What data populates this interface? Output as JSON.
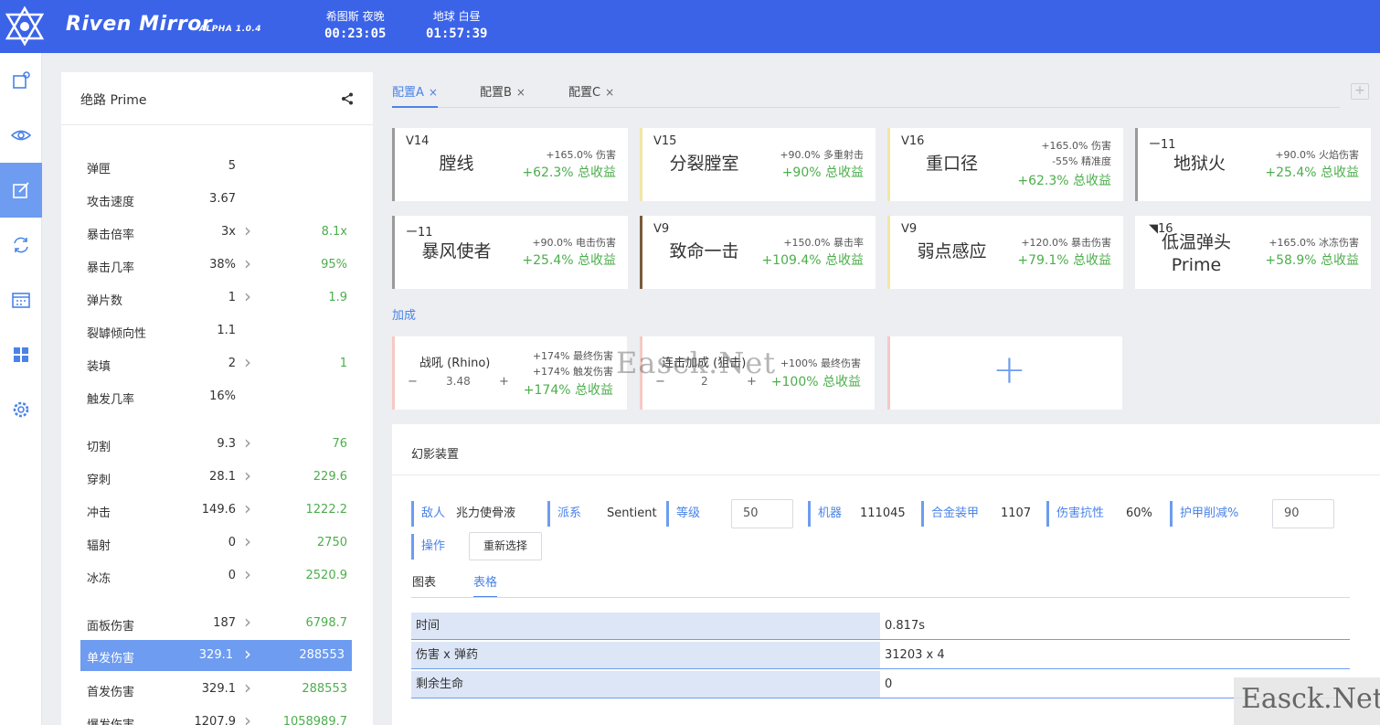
{
  "app": {
    "brand": "Riven Mirror",
    "version": "ALPHA 1.0.4",
    "clocks": [
      {
        "name": "希图斯 夜晚",
        "time": "00:23:05"
      },
      {
        "name": "地球 白昼",
        "time": "01:57:39"
      }
    ],
    "colors": {
      "topbar": "#3b63e8",
      "accent": "#4a83e8",
      "positive": "#4cae4c"
    }
  },
  "rail": [
    "riven-icon",
    "eye-icon",
    "edit-icon",
    "sync-icon",
    "calendar-icon",
    "grid-icon",
    "settings-icon"
  ],
  "stats": {
    "title": "绝路 Prime",
    "rows": [
      {
        "label": "弹匣",
        "value": "5",
        "arrow": false,
        "result": ""
      },
      {
        "label": "攻击速度",
        "value": "3.67",
        "arrow": false,
        "result": ""
      },
      {
        "label": "暴击倍率",
        "value": "3x",
        "arrow": true,
        "result": "8.1x"
      },
      {
        "label": "暴击几率",
        "value": "38%",
        "arrow": true,
        "result": "95%"
      },
      {
        "label": "弹片数",
        "value": "1",
        "arrow": true,
        "result": "1.9"
      },
      {
        "label": "裂罅倾向性",
        "value": "1.1",
        "arrow": false,
        "result": ""
      },
      {
        "label": "装填",
        "value": "2",
        "arrow": true,
        "result": "1"
      },
      {
        "label": "触发几率",
        "value": "16%",
        "arrow": false,
        "result": ""
      },
      {
        "label": "切割",
        "value": "9.3",
        "arrow": true,
        "result": "76"
      },
      {
        "label": "穿刺",
        "value": "28.1",
        "arrow": true,
        "result": "229.6"
      },
      {
        "label": "冲击",
        "value": "149.6",
        "arrow": true,
        "result": "1222.2"
      },
      {
        "label": "辐射",
        "value": "0",
        "arrow": true,
        "result": "2750"
      },
      {
        "label": "冰冻",
        "value": "0",
        "arrow": true,
        "result": "2520.9"
      },
      {
        "label": "面板伤害",
        "value": "187",
        "arrow": true,
        "result": "6798.7"
      },
      {
        "label": "单发伤害",
        "value": "329.1",
        "arrow": true,
        "result": "288553"
      },
      {
        "label": "首发伤害",
        "value": "329.1",
        "arrow": true,
        "result": "288553"
      },
      {
        "label": "爆发伤害",
        "value": "1207.9",
        "arrow": true,
        "result": "1058989.7"
      }
    ]
  },
  "tabs": [
    {
      "label": "配置A",
      "close": "×"
    },
    {
      "label": "配置B",
      "close": "×"
    },
    {
      "label": "配置C",
      "close": "×"
    }
  ],
  "tab_add": "+",
  "mods": [
    {
      "rank": "ᐯ14",
      "name": "膛线",
      "effects": [
        "+165.0% 伤害"
      ],
      "gain": "+62.3% 总收益",
      "color": "#9a9a9a"
    },
    {
      "rank": "ᐯ15",
      "name": "分裂膛室",
      "effects": [
        "+90.0% 多重射击"
      ],
      "gain": "+90% 总收益",
      "color": "#f2e6a6"
    },
    {
      "rank": "ᐯ16",
      "name": "重口径",
      "effects": [
        "+165.0% 伤害",
        "-55% 精准度"
      ],
      "gain": "+62.3% 总收益",
      "color": "#f2e6a6"
    },
    {
      "rank": "ー11",
      "name": "地狱火",
      "effects": [
        "+90.0% 火焰伤害"
      ],
      "gain": "+25.4% 总收益",
      "color": "#9a9a9a"
    },
    {
      "rank": "ー11",
      "name": "暴风使者",
      "effects": [
        "+90.0% 电击伤害"
      ],
      "gain": "+25.4% 总收益",
      "color": "#9a9a9a"
    },
    {
      "rank": "ᐯ9",
      "name": "致命一击",
      "effects": [
        "+150.0% 暴击率"
      ],
      "gain": "+109.4% 总收益",
      "color": "#7a5a3a"
    },
    {
      "rank": "ᐯ9",
      "name": "弱点感应",
      "effects": [
        "+120.0% 暴击伤害"
      ],
      "gain": "+79.1% 总收益",
      "color": "#f2e6a6"
    },
    {
      "rank": "◥16",
      "name": "低温弹头 Prime",
      "effects": [
        "+165.0% 冰冻伤害"
      ],
      "gain": "+58.9% 总收益",
      "color": "#ffffff"
    }
  ],
  "buff_section": "加成",
  "buffs": [
    {
      "name": "战吼 (Rhino)",
      "value": "3.48",
      "minus": "−",
      "plus": "+",
      "effects": [
        "+174% 最终伤害",
        "+174% 触发伤害"
      ],
      "gain": "+174% 总收益"
    },
    {
      "name": "连击加成 (狙击)",
      "value": "2",
      "minus": "−",
      "plus": "+",
      "effects": [
        "+100% 最终伤害"
      ],
      "gain": "+100% 总收益"
    }
  ],
  "buff_add": "+",
  "sim": {
    "title": "幻影装置",
    "fields": [
      {
        "key": "敌人",
        "value": "兆力使骨液"
      },
      {
        "key": "派系",
        "value": "Sentient"
      },
      {
        "key": "等级",
        "value": "50"
      },
      {
        "key": "机器",
        "value": "111045"
      },
      {
        "key": "合金装甲",
        "value": "1107"
      },
      {
        "key": "伤害抗性",
        "value": "60%"
      },
      {
        "key": "护甲削减%",
        "value": "90"
      },
      {
        "key": "操作",
        "value": "重新选择"
      }
    ],
    "subtabs": [
      "图表",
      "表格"
    ],
    "table": [
      {
        "k": "时间",
        "v": "0.817s"
      },
      {
        "k": "伤害 x 弹药",
        "v": "31203 x 4"
      },
      {
        "k": "剩余生命",
        "v": "0"
      }
    ]
  },
  "watermark": "Easck.Net"
}
